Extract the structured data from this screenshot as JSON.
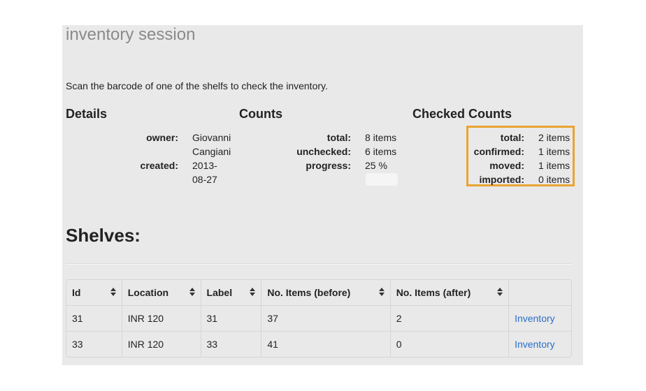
{
  "page": {
    "title": "inventory session",
    "instructions": "Scan the barcode of one of the shelfs to check the inventory."
  },
  "details": {
    "heading": "Details",
    "owner_label": "owner:",
    "owner_value": "Giovanni Cangiani",
    "created_label": "created:",
    "created_value": "2013-08-27"
  },
  "counts": {
    "heading": "Counts",
    "total_label": "total:",
    "total_value": "8 items",
    "unchecked_label": "unchecked:",
    "unchecked_value": "6 items",
    "progress_label": "progress:",
    "progress_value": "25 %",
    "progress_fraction": 0.25
  },
  "checked_counts": {
    "heading": "Checked Counts",
    "total_label": "total:",
    "total_value": "2 items",
    "confirmed_label": "confirmed:",
    "confirmed_value": "1 items",
    "moved_label": "moved:",
    "moved_value": "1 items",
    "imported_label": "imported:",
    "imported_value": "0 items",
    "highlight_color": "#e8a431"
  },
  "shelves": {
    "heading": "Shelves:",
    "columns": [
      "Id",
      "Location",
      "Label",
      "No. Items (before)",
      "No. Items (after)",
      ""
    ],
    "rows": [
      {
        "id": "31",
        "location": "INR 120",
        "label": "31",
        "before": "37",
        "after": "2",
        "link": "Inventory"
      },
      {
        "id": "33",
        "location": "INR 120",
        "label": "33",
        "before": "41",
        "after": "0",
        "link": "Inventory"
      }
    ]
  },
  "colors": {
    "panel_bg": "#e9e9e9",
    "link": "#2a6fc9"
  }
}
